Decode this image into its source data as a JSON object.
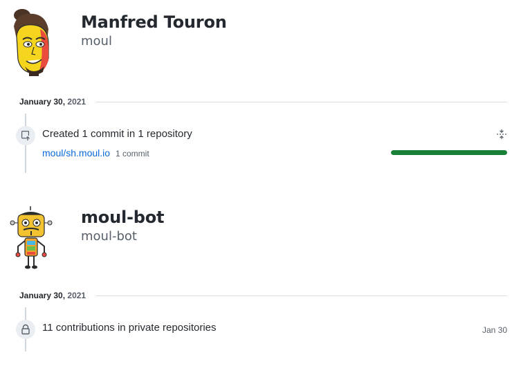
{
  "users": [
    {
      "name": "Manfred Touron",
      "login": "moul",
      "date_month_day": "January 30,",
      "date_year": "2021",
      "event": {
        "title": "Created 1 commit in 1 repository",
        "repo": "moul/sh.moul.io",
        "commits": "1 commit",
        "progress": 1.0
      }
    },
    {
      "name": "moul-bot",
      "login": "moul-bot",
      "date_month_day": "January 30,",
      "date_year": "2021",
      "event": {
        "title": "11 contributions in private repositories",
        "date": "Jan 30"
      }
    }
  ],
  "colors": {
    "link": "#0969da",
    "progress": "#1a7f37",
    "muted": "#57606a"
  },
  "icons": {
    "commit_event": "repo-push-icon",
    "private_event": "lock-icon",
    "collapse": "fold-icon"
  }
}
